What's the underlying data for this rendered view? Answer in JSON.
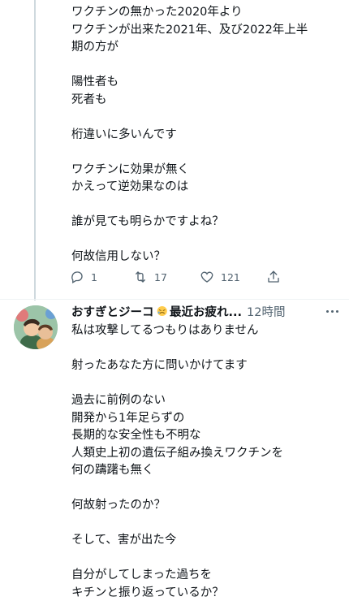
{
  "tweet1": {
    "paragraphs": [
      [
        "ワクチンの無かった2020年より",
        "ワクチンが出来た2021年、及び2022年上半",
        "期の方が"
      ],
      [
        "陽性者も",
        "死者も"
      ],
      [
        "桁違いに多いんです"
      ],
      [
        "ワクチンに効果が無く",
        "かえって逆効果なのは"
      ],
      [
        "誰が見ても明らかですよね？"
      ],
      [
        "何故信用しない？"
      ]
    ],
    "actions": {
      "reply_count": "1",
      "retweet_count": "17",
      "like_count": "121"
    }
  },
  "tweet2": {
    "name": "おすぎとジーコ",
    "name_suffix": "最近お疲れ...",
    "time": "12時間",
    "paragraphs": [
      [
        "私は攻撃してるつもりはありません"
      ],
      [
        "射ったあなた方に問いかけてます"
      ],
      [
        "過去に前例のない",
        "開発から1年足らずの",
        "長期的な安全性も不明な",
        "人類史上初の遺伝子組み換えワクチンを",
        "何の躊躇も無く"
      ],
      [
        "何故射ったのか？"
      ],
      [
        "そして、害が出た今"
      ],
      [
        "自分がしてしまった過ちを",
        "キチンと振り返っているか？"
      ]
    ]
  },
  "icons": {
    "reply": "reply-icon",
    "retweet": "retweet-icon",
    "like": "heart-icon",
    "share": "share-icon",
    "more": "more-icon",
    "emoji": "tired-face-emoji"
  },
  "colors": {
    "text": "#0f1419",
    "secondary": "#536471",
    "thread_line": "#cfd9de",
    "divider": "#eff3f4"
  }
}
